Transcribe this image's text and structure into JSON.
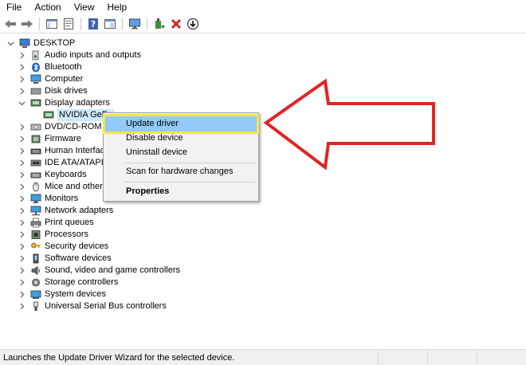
{
  "menu": [
    "File",
    "Action",
    "View",
    "Help"
  ],
  "toolbar": {
    "icons": [
      "back-arrow-icon",
      "forward-arrow-icon",
      "show-hide-console-tree-icon",
      "properties-icon",
      "help-icon",
      "console-view-icon",
      "monitor-icon",
      "update-driver-icon",
      "uninstall-icon",
      "download-icon"
    ]
  },
  "tree": {
    "root": "DESKTOP",
    "items": [
      {
        "label": "Audio inputs and outputs",
        "icon": "speaker-icon",
        "expanded": false
      },
      {
        "label": "Bluetooth",
        "icon": "bluetooth-icon",
        "expanded": false
      },
      {
        "label": "Computer",
        "icon": "computer-icon",
        "expanded": false
      },
      {
        "label": "Disk drives",
        "icon": "disk-drive-icon",
        "expanded": false
      },
      {
        "label": "Display adapters",
        "icon": "display-adapter-icon",
        "expanded": true
      },
      {
        "label": "NVIDIA GeFo",
        "icon": "gpu-icon",
        "child": true,
        "selected": true
      },
      {
        "label": "DVD/CD-ROM d",
        "icon": "dvd-drive-icon",
        "expanded": false
      },
      {
        "label": "Firmware",
        "icon": "firmware-icon",
        "expanded": false
      },
      {
        "label": "Human Interface",
        "icon": "keyboard-icon",
        "expanded": false
      },
      {
        "label": "IDE ATA/ATAPI c",
        "icon": "ide-controller-icon",
        "expanded": false
      },
      {
        "label": "Keyboards",
        "icon": "keyboard-icon",
        "expanded": false
      },
      {
        "label": "Mice and other p",
        "icon": "mouse-icon",
        "expanded": false
      },
      {
        "label": "Monitors",
        "icon": "monitor-icon",
        "expanded": false
      },
      {
        "label": "Network adapters",
        "icon": "network-icon",
        "expanded": false
      },
      {
        "label": "Print queues",
        "icon": "printer-icon",
        "expanded": false
      },
      {
        "label": "Processors",
        "icon": "processor-icon",
        "expanded": false
      },
      {
        "label": "Security devices",
        "icon": "security-key-icon",
        "expanded": false
      },
      {
        "label": "Software devices",
        "icon": "software-device-icon",
        "expanded": false
      },
      {
        "label": "Sound, video and game controllers",
        "icon": "speaker-icon",
        "expanded": false
      },
      {
        "label": "Storage controllers",
        "icon": "storage-controller-icon",
        "expanded": false
      },
      {
        "label": "System devices",
        "icon": "system-device-icon",
        "expanded": false
      },
      {
        "label": "Universal Serial Bus controllers",
        "icon": "usb-icon",
        "expanded": false
      }
    ]
  },
  "context_menu": {
    "update_driver": "Update driver",
    "disable_device": "Disable device",
    "uninstall_device": "Uninstall device",
    "scan_hardware": "Scan for hardware changes",
    "properties": "Properties"
  },
  "status": {
    "text": "Launches the Update Driver Wizard for the selected device."
  },
  "colors": {
    "highlight": "#91c9f7",
    "callout_yellow": "#f2e64a",
    "arrow_red": "#e02424",
    "selection": "#cce8ff"
  }
}
